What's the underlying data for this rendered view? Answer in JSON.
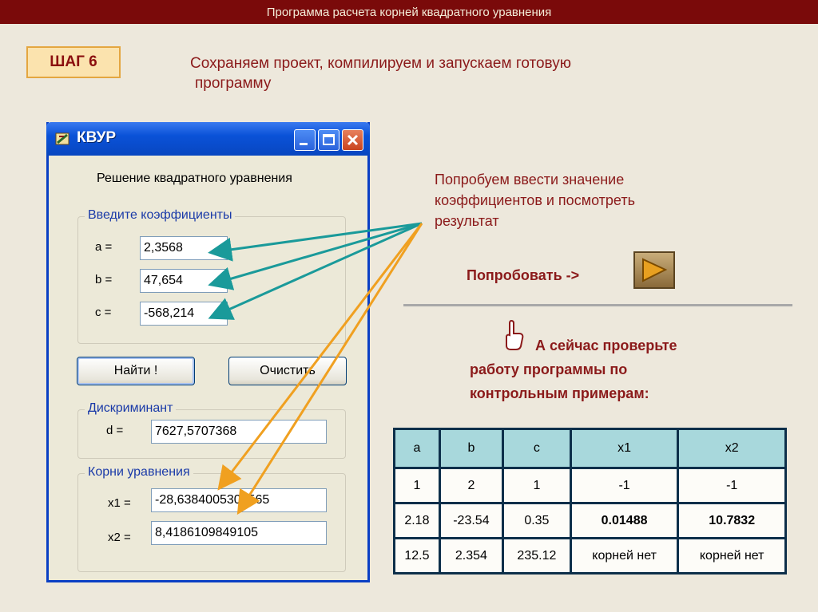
{
  "header": {
    "title": "Программа расчета корней квадратного уравнения"
  },
  "step": {
    "label": "ШАГ 6"
  },
  "intro": {
    "line1": "Сохраняем проект, компилируем и запускаем готовую",
    "line2": "программу"
  },
  "window": {
    "title": "КВУР",
    "heading": "Решение квадратного уравнения",
    "coeff_group": "Введите коэффициенты",
    "labels": {
      "a": "a =",
      "b": "b =",
      "c": "c =",
      "d": "d =",
      "x1": "x1 =",
      "x2": "x2 ="
    },
    "values": {
      "a": "2,3568",
      "b": "47,654",
      "c": "-568,214",
      "d": "7627,5707368",
      "x1": "-28,6384005300565",
      "x2": "8,4186109849105"
    },
    "find_button": "Найти !",
    "clear_button": "Очистить",
    "discriminant_group": "Дискриминант",
    "roots_group": "Корни уравнения"
  },
  "try": {
    "line1": "Попробуем ввести значение",
    "line2": "коэффициентов и посмотреть",
    "line3": "результат",
    "action_label": "Попробовать ->"
  },
  "check": {
    "line1": "А сейчас проверьте",
    "line2": "работу программы по",
    "line3": "контрольным примерам:"
  },
  "table": {
    "headers": [
      "a",
      "b",
      "c",
      "x1",
      "x2"
    ],
    "rows": [
      [
        "1",
        "2",
        "1",
        "-1",
        "-1"
      ],
      [
        "2.18",
        "-23.54",
        "0.35",
        "0.01488",
        "10.7832"
      ],
      [
        "12.5",
        "2.354",
        "235.12",
        "корней нет",
        "корней нет"
      ]
    ]
  },
  "colors": {
    "header_bg": "#7a0a0a",
    "accent_text": "#8b1a1a",
    "teal_arrow": "#1a9a9a",
    "orange_arrow": "#f0a020",
    "table_header_bg": "#a8d8dc"
  },
  "icons": {
    "app": "app-icon",
    "hand": "pointing-hand-icon",
    "play": "play-triangle-icon"
  }
}
